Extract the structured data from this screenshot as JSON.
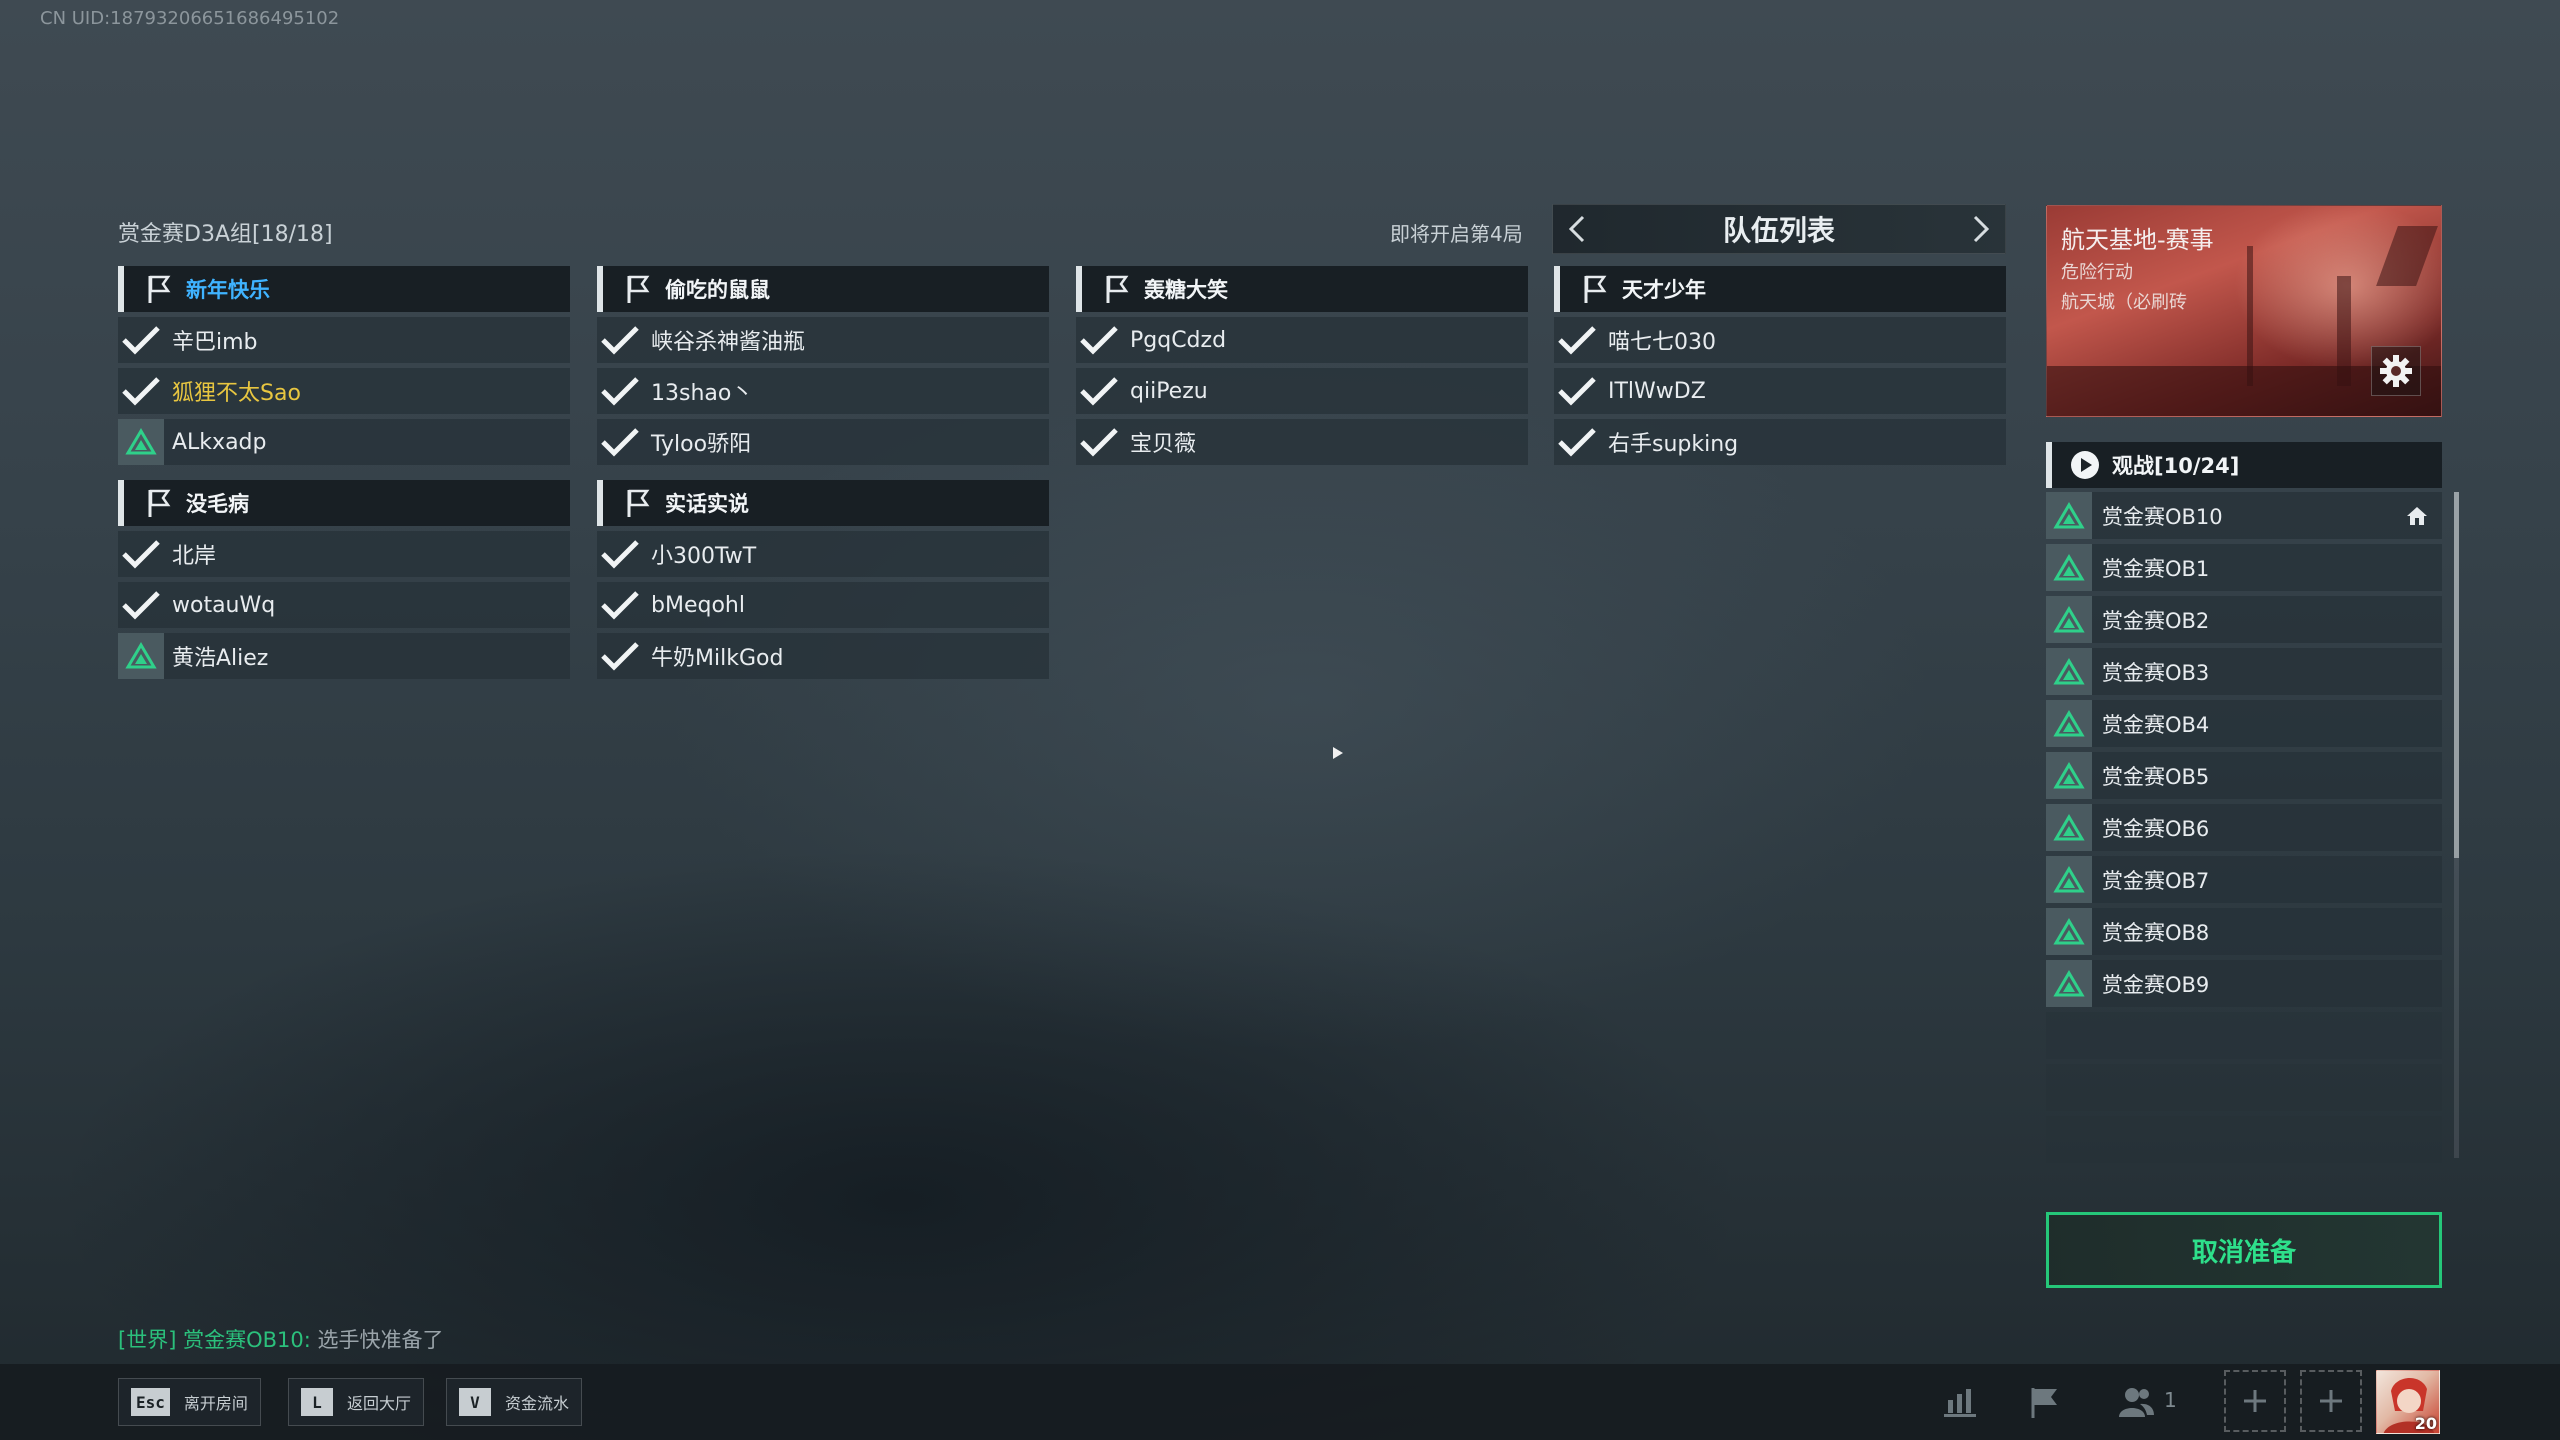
{
  "uid_text": "CN UID:1879320665168649510​2",
  "lobby": {
    "title": "赏金赛D3A组[18/18]",
    "round_status": "即将开启第4局",
    "team_list_title": "队伍列表"
  },
  "teams": [
    {
      "name": "新年快乐",
      "players": [
        {
          "name": "辛巴imb",
          "state": "ready"
        },
        {
          "name": "狐狸不太Sao",
          "state": "ready"
        },
        {
          "name": "ALkxadp",
          "state": "host"
        }
      ]
    },
    {
      "name": "偷吃的鼠鼠",
      "players": [
        {
          "name": "峡谷杀神酱油瓶",
          "state": "ready"
        },
        {
          "name": "13shao丶",
          "state": "ready"
        },
        {
          "name": "Tyloo骄阳",
          "state": "ready"
        }
      ]
    },
    {
      "name": "轰糖大笑",
      "players": [
        {
          "name": "PgqCdzd",
          "state": "ready"
        },
        {
          "name": "qiiPezu",
          "state": "ready"
        },
        {
          "name": "宝贝薇",
          "state": "ready"
        }
      ]
    },
    {
      "name": "天才少年",
      "players": [
        {
          "name": "喵七七030",
          "state": "ready"
        },
        {
          "name": "ITlWwDZ",
          "state": "ready"
        },
        {
          "name": "右手supking",
          "state": "ready"
        }
      ]
    },
    {
      "name": "没毛病",
      "players": [
        {
          "name": "北岸",
          "state": "ready"
        },
        {
          "name": "wotauWq",
          "state": "ready"
        },
        {
          "name": "黄浩Aliez",
          "state": "host"
        }
      ]
    },
    {
      "name": "实话实说",
      "players": [
        {
          "name": "小300TwT",
          "state": "ready"
        },
        {
          "name": "bMeqohl",
          "state": "ready"
        },
        {
          "name": "牛奶MilkGod",
          "state": "ready"
        }
      ]
    }
  ],
  "banner": {
    "title": "航天基地-赛事",
    "mode": "危险行动",
    "map": "航天城（必刷砖"
  },
  "spectators": {
    "title": "观战[10/24]",
    "list": [
      "赏金赛OB10",
      "赏金赛OB1",
      "赏金赛OB2",
      "赏金赛OB3",
      "赏金赛OB4",
      "赏金赛OB5",
      "赏金赛OB6",
      "赏金赛OB7",
      "赏金赛OB8",
      "赏金赛OB9"
    ]
  },
  "cancel_ready_label": "取消准备",
  "chat": {
    "channel": "[世界]",
    "sender": "赏金赛OB10:",
    "message": "选手快准备了"
  },
  "hotkeys": [
    {
      "key": "Esc",
      "label": "离开房间"
    },
    {
      "key": "L",
      "label": "返回大厅"
    },
    {
      "key": "V",
      "label": "资金流水"
    }
  ],
  "friends_online": "1",
  "player_level": "20",
  "colors": {
    "accent_green": "#25c779",
    "self_name": "#e8c640",
    "team_highlight": "#3fb3ff"
  }
}
